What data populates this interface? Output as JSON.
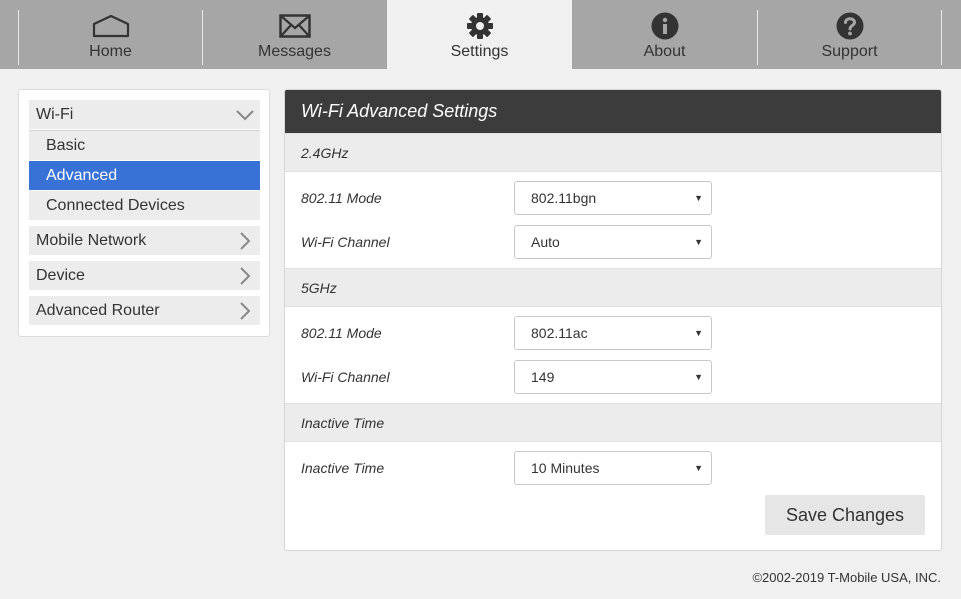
{
  "nav": {
    "tabs": [
      {
        "label": "Home",
        "icon": "home-icon"
      },
      {
        "label": "Messages",
        "icon": "envelope-icon"
      },
      {
        "label": "Settings",
        "icon": "gear-icon"
      },
      {
        "label": "About",
        "icon": "info-icon"
      },
      {
        "label": "Support",
        "icon": "question-icon"
      }
    ],
    "active": "Settings"
  },
  "sidebar": {
    "wifi": "Wi-Fi",
    "wifi_items": [
      "Basic",
      "Advanced",
      "Connected Devices"
    ],
    "active_item": "Advanced",
    "mobile_network": "Mobile Network",
    "device": "Device",
    "advanced_router": "Advanced Router"
  },
  "panel": {
    "title": "Wi-Fi Advanced Settings",
    "band_24": {
      "header": "2.4GHz",
      "mode_label": "802.11 Mode",
      "mode_value": "802.11bgn",
      "channel_label": "Wi-Fi Channel",
      "channel_value": "Auto"
    },
    "band_5": {
      "header": "5GHz",
      "mode_label": "802.11 Mode",
      "mode_value": "802.11ac",
      "channel_label": "Wi-Fi Channel",
      "channel_value": "149"
    },
    "inactive": {
      "header": "Inactive Time",
      "label": "Inactive Time",
      "value": "10 Minutes"
    },
    "save_label": "Save Changes"
  },
  "footer": "©2002-2019 T-Mobile USA, INC.",
  "colors": {
    "nav_bg": "#a6a6a6",
    "active_blue": "#3872d6",
    "title_bar": "#3c3c3c"
  }
}
